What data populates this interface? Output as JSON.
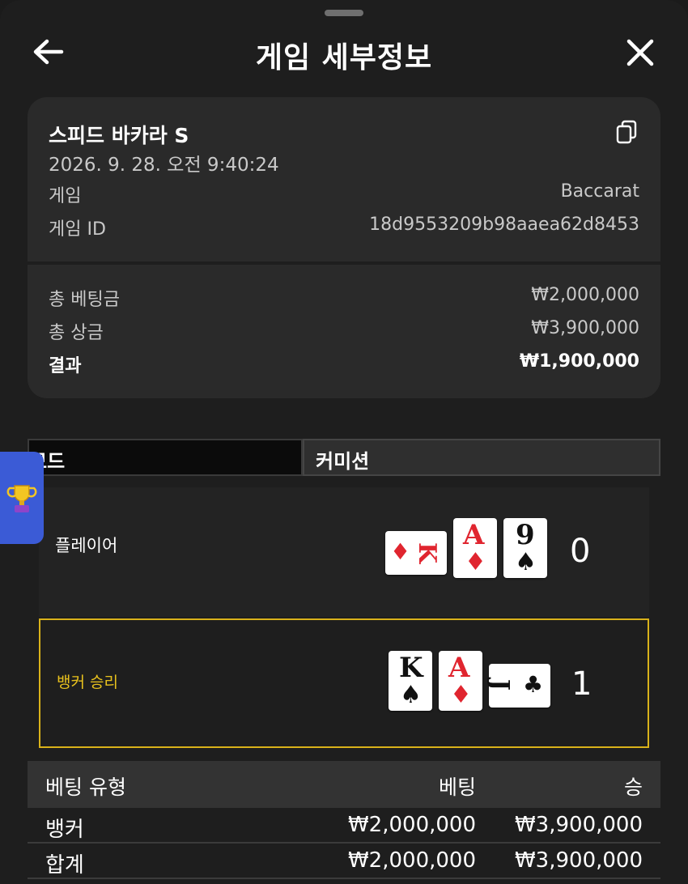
{
  "header": {
    "title": "게임 세부정보",
    "back_icon": "arrow-left-icon",
    "close_icon": "close-icon"
  },
  "game": {
    "name": "스피드 바카라 S",
    "datetime": "2026. 9. 28. 오전 9:40:24",
    "game_label": "게임",
    "game_value": "Baccarat",
    "id_label": "게임 ID",
    "id_value": "18d9553209b98aaea62d8453"
  },
  "summary": {
    "total_bet_label": "총 베팅금",
    "total_bet_value": "₩2,000,000",
    "total_win_label": "총 상금",
    "total_win_value": "₩3,900,000",
    "result_label": "결과",
    "result_value": "₩1,900,000"
  },
  "tabs": {
    "mode": "모드",
    "commission": "커미션"
  },
  "player": {
    "label": "플레이어",
    "score": "0",
    "cards": [
      {
        "rank": "K",
        "suit": "♦",
        "orientation": "sideways"
      },
      {
        "rank": "A",
        "suit": "♦",
        "orientation": "upright"
      },
      {
        "rank": "9",
        "suit": "♠",
        "orientation": "upright"
      }
    ]
  },
  "banker": {
    "label": "뱅커 승리",
    "score": "1",
    "cards": [
      {
        "rank": "K",
        "suit": "♠",
        "orientation": "upright"
      },
      {
        "rank": "A",
        "suit": "♦",
        "orientation": "upright"
      },
      {
        "rank": "J",
        "suit": "♣",
        "orientation": "sideways"
      }
    ]
  },
  "bets": {
    "headers": [
      "베팅 유형",
      "베팅",
      "승"
    ],
    "rows": [
      [
        "뱅커",
        "₩2,000,000",
        "₩3,900,000"
      ],
      [
        "합계",
        "₩2,000,000",
        "₩3,900,000"
      ]
    ]
  },
  "colors": {
    "background": "#1e1e1e",
    "card_bg": "#2a2a2a",
    "banker_win_accent": "#e9c21d",
    "side_tab": "#3b5bd6",
    "card_red": "#e0252f"
  }
}
